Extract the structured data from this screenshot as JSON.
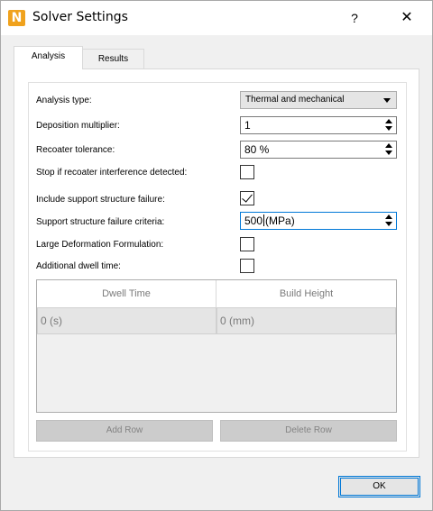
{
  "window": {
    "title": "Solver Settings",
    "app_icon_letter": "N",
    "help_glyph": "?",
    "close_glyph": "✕"
  },
  "tabs": [
    {
      "label": "Analysis",
      "active": true
    },
    {
      "label": "Results",
      "active": false
    }
  ],
  "form": {
    "analysis_type": {
      "label": "Analysis type:",
      "value": "Thermal and mechanical"
    },
    "deposition_multiplier": {
      "label": "Deposition multiplier:",
      "value": "1"
    },
    "recoater_tolerance": {
      "label": "Recoater tolerance:",
      "value": "80 %"
    },
    "stop_recoater": {
      "label": "Stop if recoater interference detected:",
      "checked": false
    },
    "include_support_failure": {
      "label": "Include support structure failure:",
      "checked": true
    },
    "support_failure_criteria": {
      "label": "Support structure failure criteria:",
      "value": "500",
      "unit": "(MPa)"
    },
    "large_deformation": {
      "label": "Large Deformation Formulation:",
      "checked": false
    },
    "additional_dwell": {
      "label": "Additional dwell time:",
      "checked": false
    }
  },
  "dwell_table": {
    "columns": [
      "Dwell Time",
      "Build Height"
    ],
    "rows": [
      [
        "0 (s)",
        "0 (mm)"
      ]
    ]
  },
  "buttons": {
    "add_row": "Add Row",
    "delete_row": "Delete Row",
    "ok": "OK"
  },
  "colors": {
    "accent": "#0078d7",
    "app_icon": "#f0a21d"
  }
}
